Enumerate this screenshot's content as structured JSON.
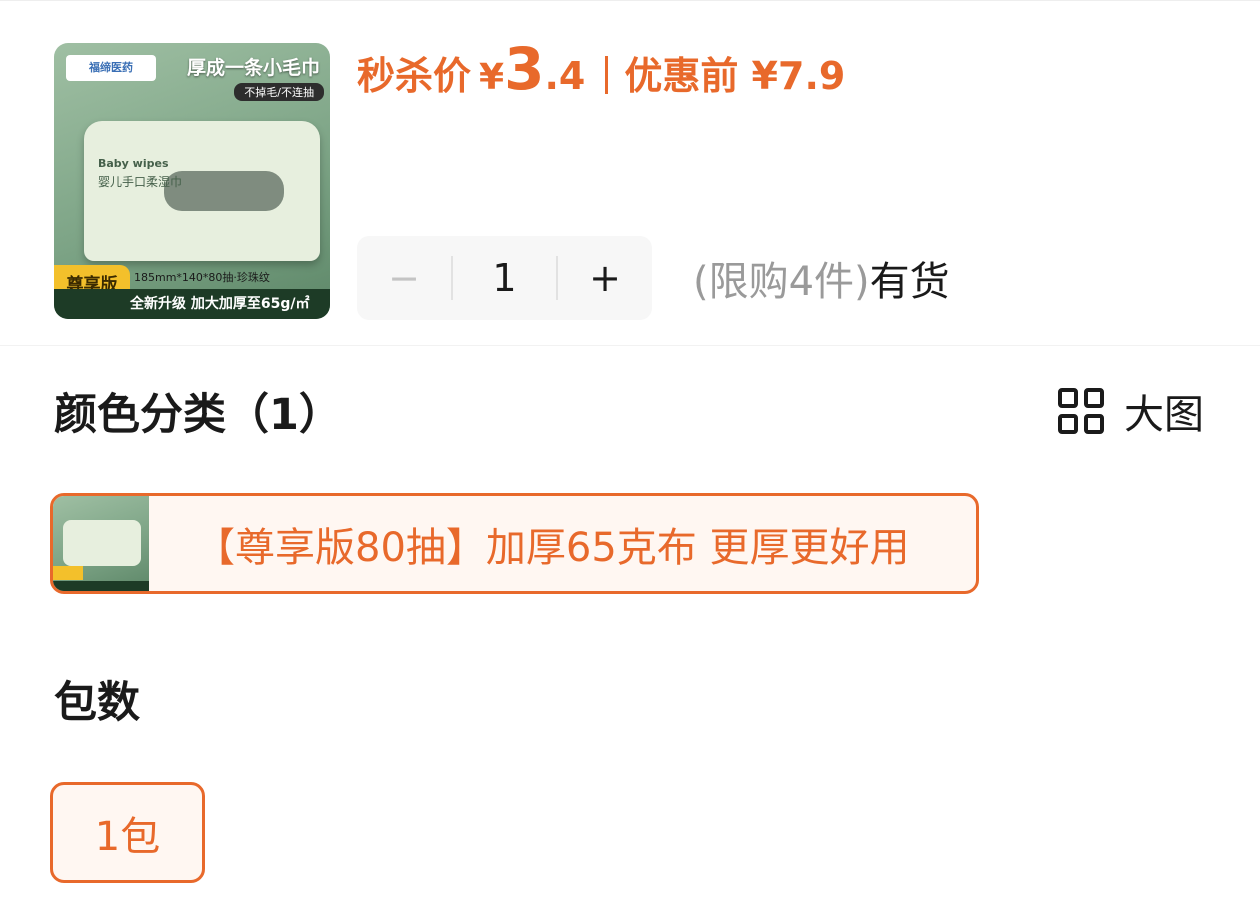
{
  "product": {
    "thumb": {
      "headline": "厚成一条小毛巾",
      "subtag": "不掉毛/不连抽",
      "logo_text": "福缔医药",
      "box_label_en": "Baby wipes",
      "box_label_cn": "婴儿手口柔湿巾",
      "spec": "185mm*140*80抽·珍珠纹",
      "badge": "尊享版",
      "strip": "全新升级 加大加厚至65g/㎡"
    },
    "price": {
      "label": "秒杀价",
      "yen": "¥",
      "integer": "3",
      "decimal": ".4",
      "original": "优惠前 ¥7.9"
    },
    "quantity": {
      "minus": "−",
      "value": "1",
      "plus": "+"
    },
    "limit": "(限购4件)",
    "stock": "有货"
  },
  "color_section": {
    "title": "颜色分类（1）",
    "big_view_label": "大图",
    "options": [
      {
        "label": "【尊享版80抽】加厚65克布 更厚更好用"
      }
    ]
  },
  "pack_section": {
    "title": "包数",
    "options": [
      {
        "label": "1包"
      }
    ]
  },
  "colors": {
    "accent": "#e8692b",
    "selected_bg": "#fff7f2",
    "muted_text": "#9a9a9a"
  }
}
